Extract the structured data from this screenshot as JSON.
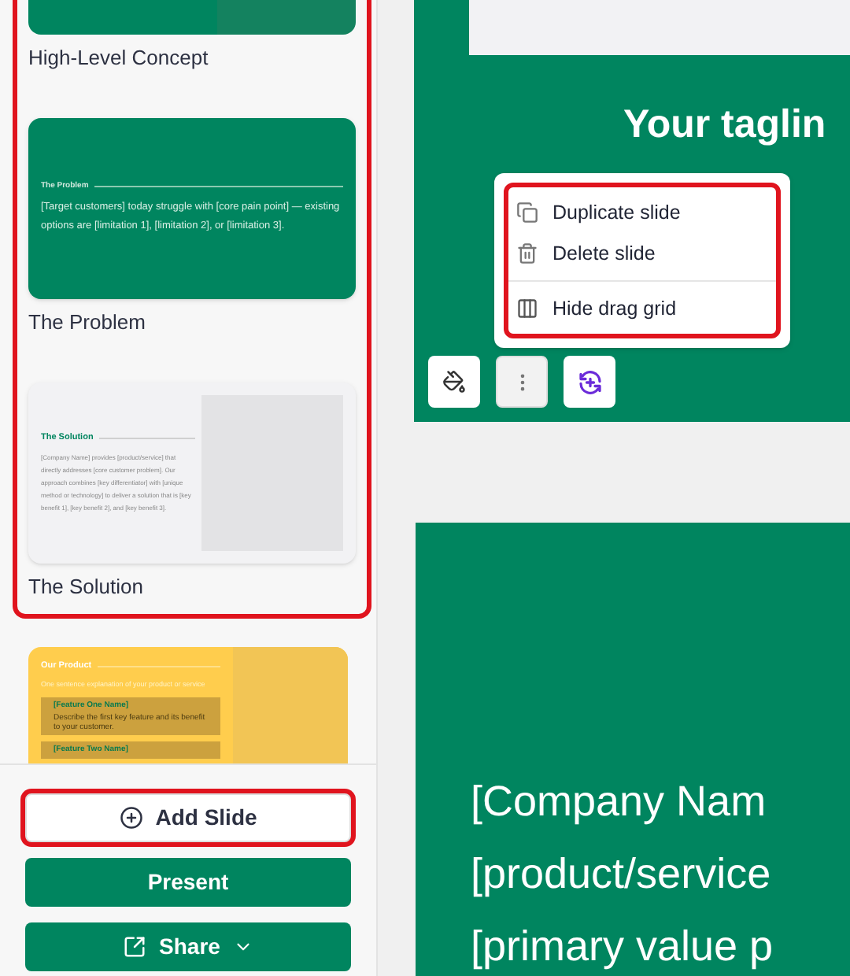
{
  "sidebar": {
    "slides": [
      {
        "kind": "concept",
        "label": "High-Level Concept",
        "highlighted": true
      },
      {
        "kind": "problem",
        "label": "The Problem",
        "highlighted": true,
        "title": "The Problem",
        "body": "[Target customers] today struggle with [core pain point] — existing options are [limitation 1], [limitation 2], or [limitation 3]."
      },
      {
        "kind": "solution",
        "label": "The Solution",
        "highlighted": true,
        "title": "The Solution",
        "body": "[Company Name] provides [product/service] that directly addresses [core customer problem]. Our approach combines [key differentiator] with [unique method or technology] to deliver a solution that is [key benefit 1], [key benefit 2], and [key benefit 3]."
      },
      {
        "kind": "product",
        "highlighted": false,
        "title": "Our Product",
        "body": "One sentence explanation of your product or service",
        "features": [
          {
            "name": "[Feature One Name]",
            "description": "Describe the first key feature and its benefit to your customer."
          },
          {
            "name": "[Feature Two Name]"
          }
        ]
      }
    ],
    "buttons": [
      {
        "kind": "add",
        "label": "Add Slide",
        "highlighted": true
      },
      {
        "kind": "present",
        "label": "Present",
        "highlighted": false
      },
      {
        "kind": "share",
        "label": "Share",
        "highlighted": false
      }
    ]
  },
  "editor": {
    "tagline": "Your taglin",
    "menu": {
      "highlighted": true,
      "items": [
        {
          "kind": "duplicate",
          "label": "Duplicate slide",
          "divider_before": false
        },
        {
          "kind": "delete",
          "label": "Delete slide",
          "divider_before": false
        },
        {
          "kind": "grid",
          "label": "Hide drag grid",
          "divider_before": true
        }
      ]
    },
    "toolbar": [
      {
        "kind": "paint",
        "active": false
      },
      {
        "kind": "more",
        "active": true
      },
      {
        "kind": "swap",
        "active": false
      }
    ],
    "next_slide": {
      "lines": [
        "[Company Nam",
        "[product/service",
        "[primary value p"
      ]
    }
  }
}
